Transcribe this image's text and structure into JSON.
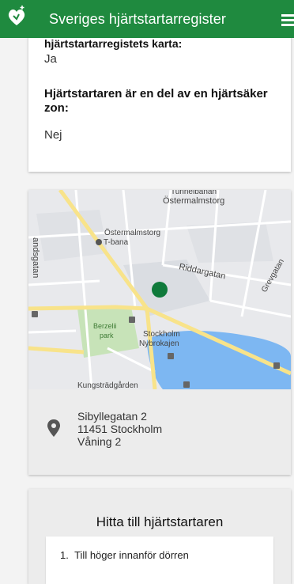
{
  "header": {
    "title": "Sveriges hjärtstartarregister"
  },
  "info": {
    "cut_label": "hjärtstartarregistets karta:",
    "value1": "Ja",
    "label2": "Hjärtstartaren är en del av en hjärtsäker zon:",
    "value2": "Nej"
  },
  "map": {
    "labels": {
      "ostermalmstorg_top": "Östermalmstorg",
      "tunnelbanan": "Tunnelbanan",
      "ostermalmstorg_tbana": "Östermalmstorg",
      "tbana": "T-bana",
      "riddargatan": "Riddargatan",
      "grevgatan": "Grevgatan",
      "berzelii": "Berzelii",
      "park": "park",
      "stockholm": "Stockholm",
      "nybrokajen": "Nybrokajen",
      "kungstradgarden": "Kungsträdgården",
      "birger": "andsgatan"
    },
    "marker_color": "#0f7a3b"
  },
  "address": {
    "line1": "Sibyllegatan 2",
    "line2": "11451 Stockholm",
    "line3": "Våning 2"
  },
  "directions": {
    "title": "Hitta till hjärtstartaren",
    "steps": [
      "Till höger innanför dörren"
    ]
  },
  "colors": {
    "brand": "#1f8a3f"
  }
}
